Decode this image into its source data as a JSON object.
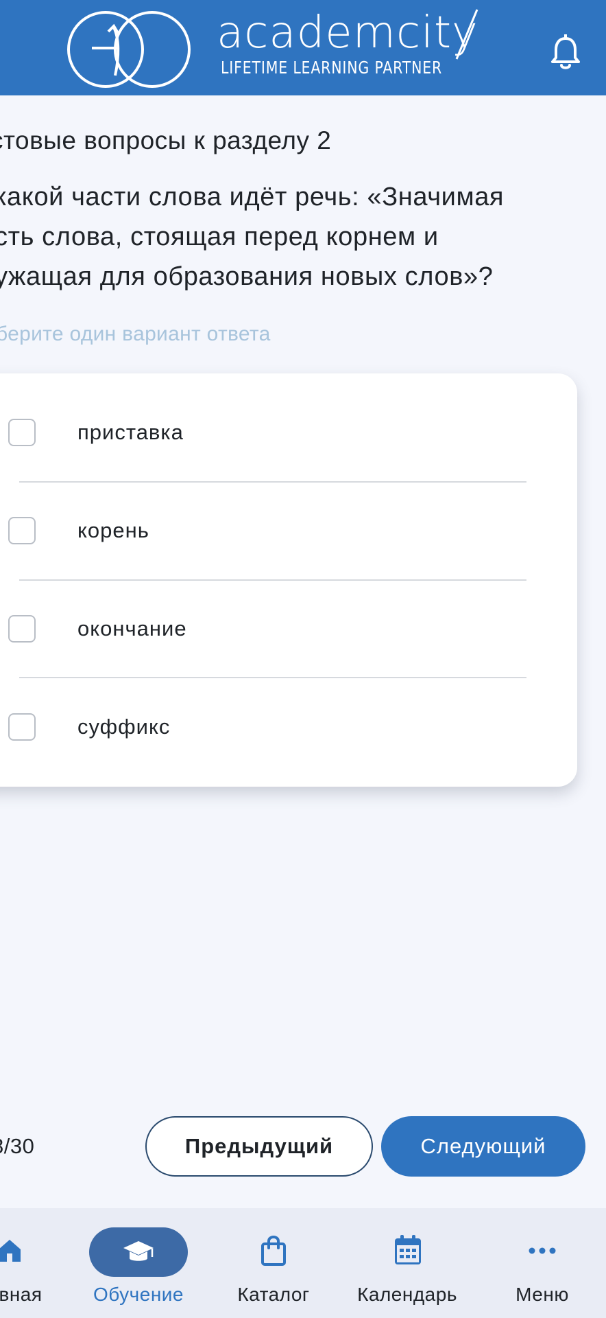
{
  "app": {
    "brand_name": "academcity",
    "tagline": "LIFETIME LEARNING PARTNER"
  },
  "quiz": {
    "section_title": "стовые вопросы к разделу 2",
    "question": "какой части слова идёт речь: «Значимая\nсть слова, стоящая перед корнем и\nужащая для образования новых слов»?",
    "hint": "берите один вариант ответа",
    "options": [
      {
        "label": "приставка",
        "checked": false
      },
      {
        "label": "корень",
        "checked": false
      },
      {
        "label": "окончание",
        "checked": false
      },
      {
        "label": "суффикс",
        "checked": false
      }
    ]
  },
  "pagination": {
    "counter": "8/30",
    "prev_label": "Предыдущий",
    "next_label": "Следующий"
  },
  "bottom_nav": {
    "items": [
      {
        "label": "вная",
        "icon": "home-icon",
        "active": false
      },
      {
        "label": "Обучение",
        "icon": "graduation-cap-icon",
        "active": true
      },
      {
        "label": "Каталог",
        "icon": "shopping-bag-icon",
        "active": false
      },
      {
        "label": "Календарь",
        "icon": "calendar-icon",
        "active": false
      },
      {
        "label": "Меню",
        "icon": "more-dots-icon",
        "active": false
      }
    ]
  },
  "colors": {
    "brand_blue": "#2f74c0",
    "active_pill": "#3d6aa6",
    "hint_text": "#a8c4dc",
    "background": "#f4f6fc"
  }
}
